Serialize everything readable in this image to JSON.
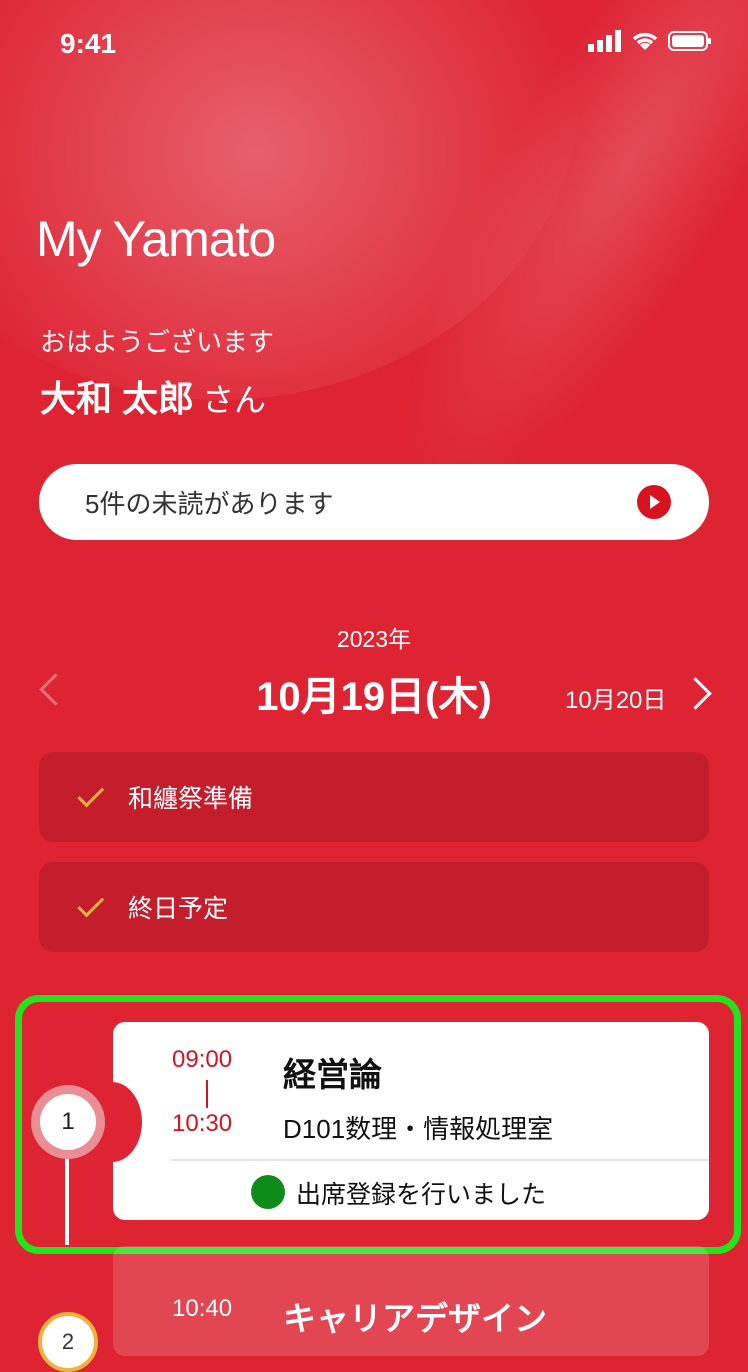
{
  "status": {
    "time": "9:41"
  },
  "app": {
    "title": "My Yamato"
  },
  "greeting": {
    "text": "おはようございます",
    "name": "大和 太郎",
    "suffix": "さん"
  },
  "notice": {
    "text": "5件の未読があります",
    "icon": "play-circle-icon"
  },
  "date": {
    "year": "2023年",
    "main": "10月19日(木)",
    "next": "10月20日"
  },
  "events": [
    {
      "label": "和纏祭準備",
      "icon": "check-icon"
    },
    {
      "label": "終日予定",
      "icon": "check-icon"
    }
  ],
  "classes": [
    {
      "number": "1",
      "start": "09:00",
      "end": "10:30",
      "title": "経営論",
      "room": "D101数理・情報処理室",
      "attendance": "出席登録を行いました"
    },
    {
      "number": "2",
      "start": "10:40",
      "title": "キャリアデザイン"
    }
  ],
  "colors": {
    "brand": "#de2333",
    "accent": "#d9121f",
    "attended": "#0d8c1a",
    "highlight": "#22e31d"
  }
}
